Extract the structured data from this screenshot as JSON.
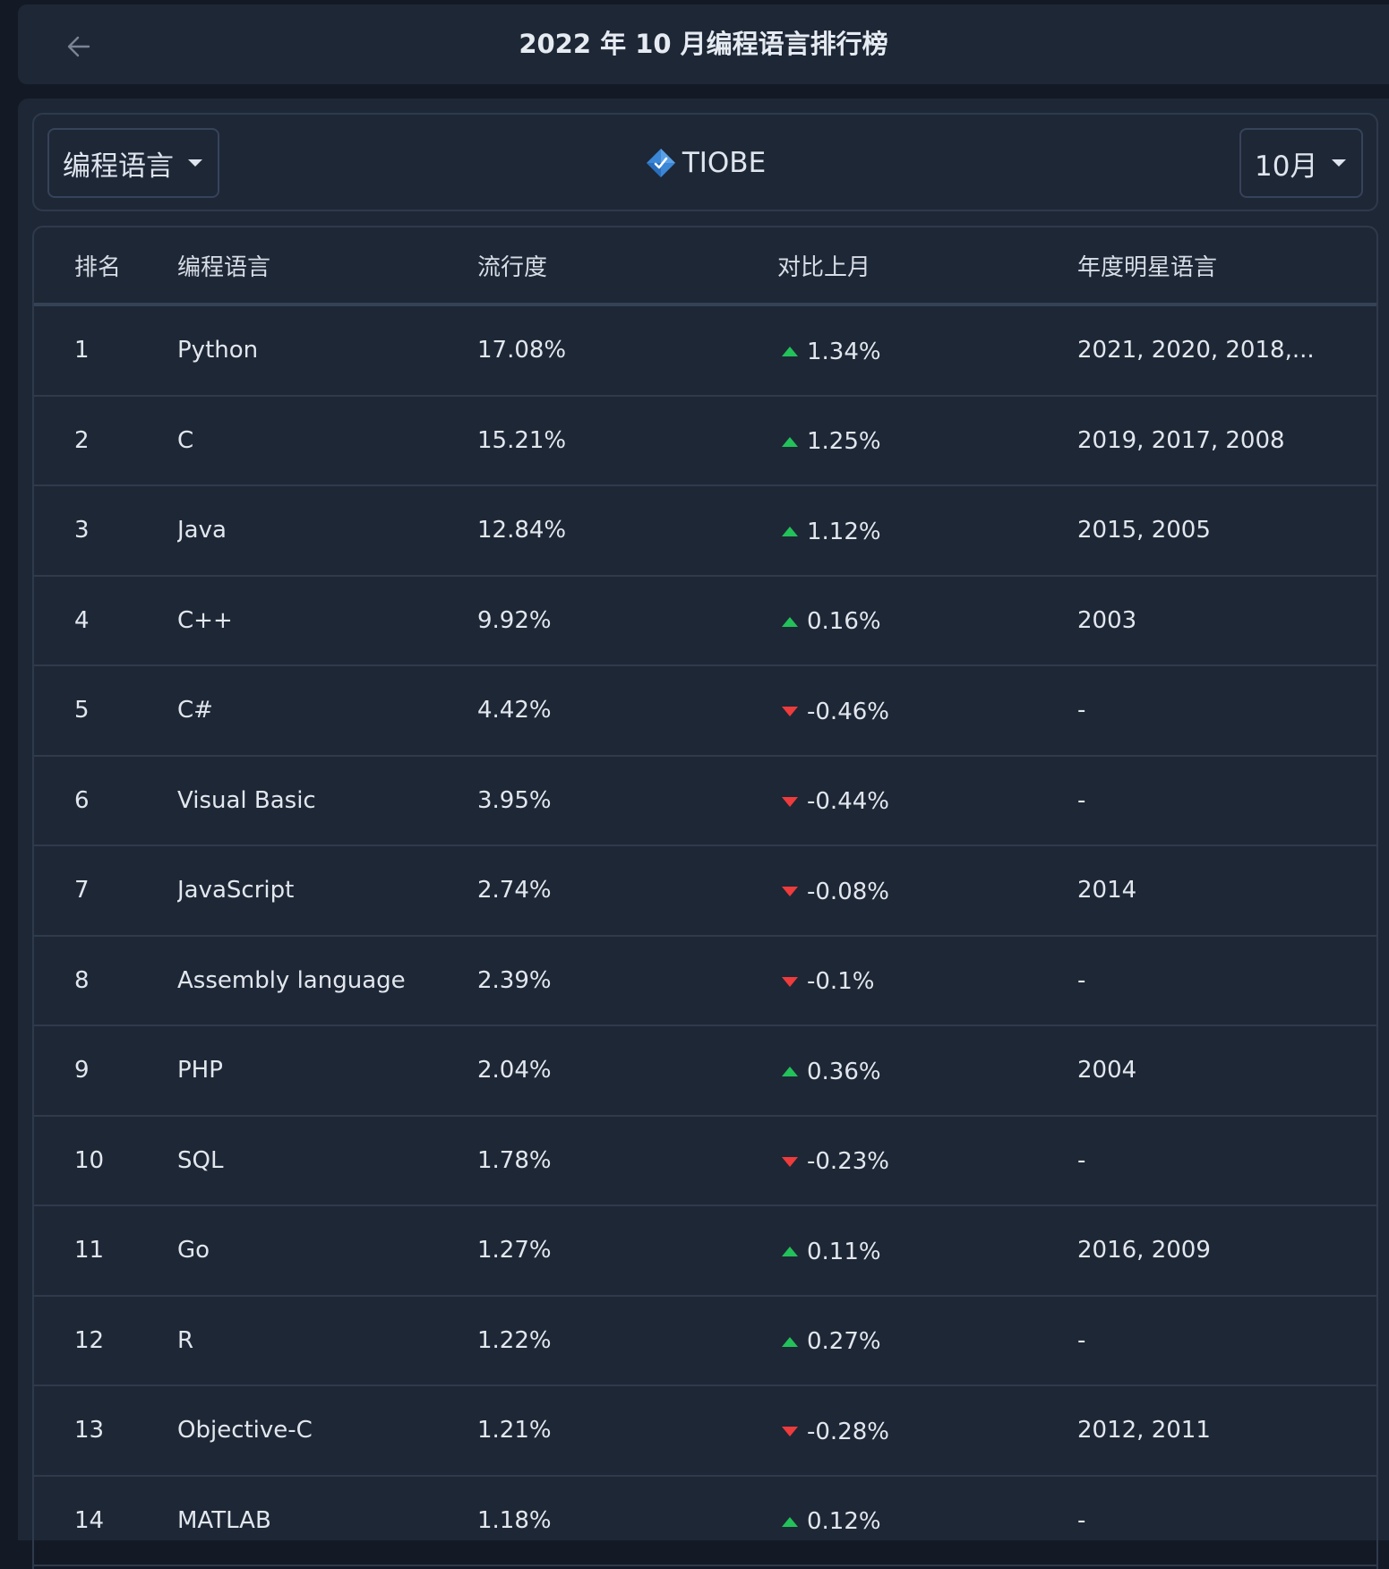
{
  "header": {
    "title": "2022 年 10 月编程语言排行榜",
    "back_icon": "arrow-left-icon"
  },
  "toolbar": {
    "category_value": "编程语言",
    "brand_name": "TIOBE",
    "brand_icon": "tiobe-logo-icon",
    "month_value": "10月"
  },
  "colors": {
    "up": "#23c15a",
    "down": "#ee3b3b",
    "background": "#1e2736"
  },
  "table": {
    "columns": [
      "排名",
      "编程语言",
      "流行度",
      "对比上月",
      "年度明星语言"
    ],
    "rows": [
      {
        "rank": "1",
        "language": "Python",
        "popularity": "17.08%",
        "change": "1.34%",
        "direction": "up",
        "stars": "2021, 2020, 2018,..."
      },
      {
        "rank": "2",
        "language": "C",
        "popularity": "15.21%",
        "change": "1.25%",
        "direction": "up",
        "stars": "2019, 2017, 2008"
      },
      {
        "rank": "3",
        "language": "Java",
        "popularity": "12.84%",
        "change": "1.12%",
        "direction": "up",
        "stars": "2015, 2005"
      },
      {
        "rank": "4",
        "language": "C++",
        "popularity": "9.92%",
        "change": "0.16%",
        "direction": "up",
        "stars": "2003"
      },
      {
        "rank": "5",
        "language": "C#",
        "popularity": "4.42%",
        "change": "-0.46%",
        "direction": "down",
        "stars": "-"
      },
      {
        "rank": "6",
        "language": "Visual Basic",
        "popularity": "3.95%",
        "change": "-0.44%",
        "direction": "down",
        "stars": "-"
      },
      {
        "rank": "7",
        "language": "JavaScript",
        "popularity": "2.74%",
        "change": "-0.08%",
        "direction": "down",
        "stars": "2014"
      },
      {
        "rank": "8",
        "language": "Assembly language",
        "popularity": "2.39%",
        "change": "-0.1%",
        "direction": "down",
        "stars": "-"
      },
      {
        "rank": "9",
        "language": "PHP",
        "popularity": "2.04%",
        "change": "0.36%",
        "direction": "up",
        "stars": "2004"
      },
      {
        "rank": "10",
        "language": "SQL",
        "popularity": "1.78%",
        "change": "-0.23%",
        "direction": "down",
        "stars": "-"
      },
      {
        "rank": "11",
        "language": "Go",
        "popularity": "1.27%",
        "change": "0.11%",
        "direction": "up",
        "stars": "2016, 2009"
      },
      {
        "rank": "12",
        "language": "R",
        "popularity": "1.22%",
        "change": "0.27%",
        "direction": "up",
        "stars": "-"
      },
      {
        "rank": "13",
        "language": "Objective-C",
        "popularity": "1.21%",
        "change": "-0.28%",
        "direction": "down",
        "stars": "2012, 2011"
      },
      {
        "rank": "14",
        "language": "MATLAB",
        "popularity": "1.18%",
        "change": "0.12%",
        "direction": "up",
        "stars": "-"
      }
    ]
  }
}
